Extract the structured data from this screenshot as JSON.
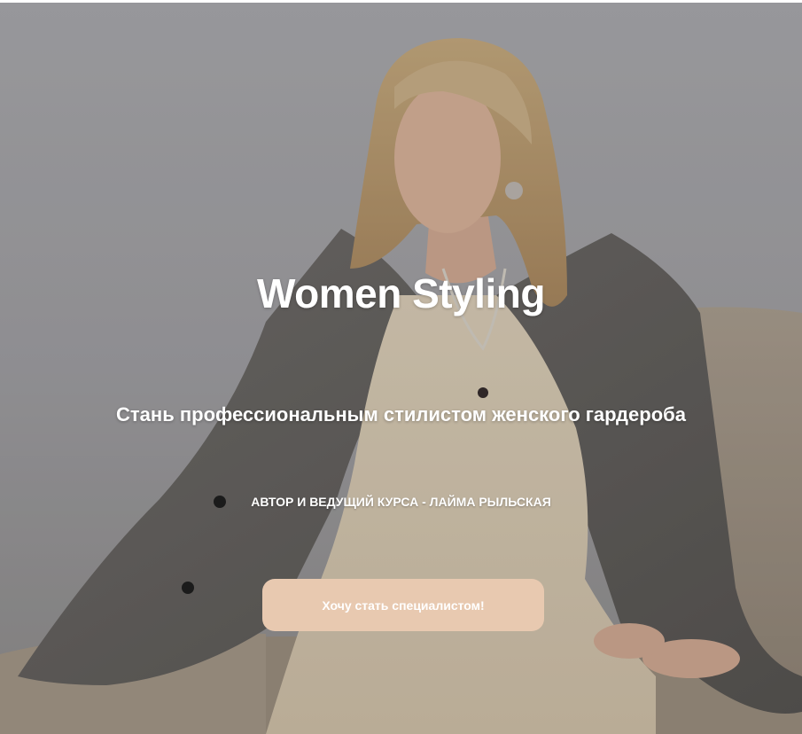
{
  "hero": {
    "title": "Women Styling",
    "subtitle": "Стань профессиональным стилистом женского гардероба",
    "author": "АВТОР И ВЕДУЩИЙ КУРСА - ЛАЙМА РЫЛЬСКАЯ",
    "cta_label": "Хочу стать специалистом!",
    "photo": "woman-in-grey-blazer-on-sofa"
  },
  "colors": {
    "cta_background": "#e8c9b0",
    "text": "#ffffff"
  }
}
